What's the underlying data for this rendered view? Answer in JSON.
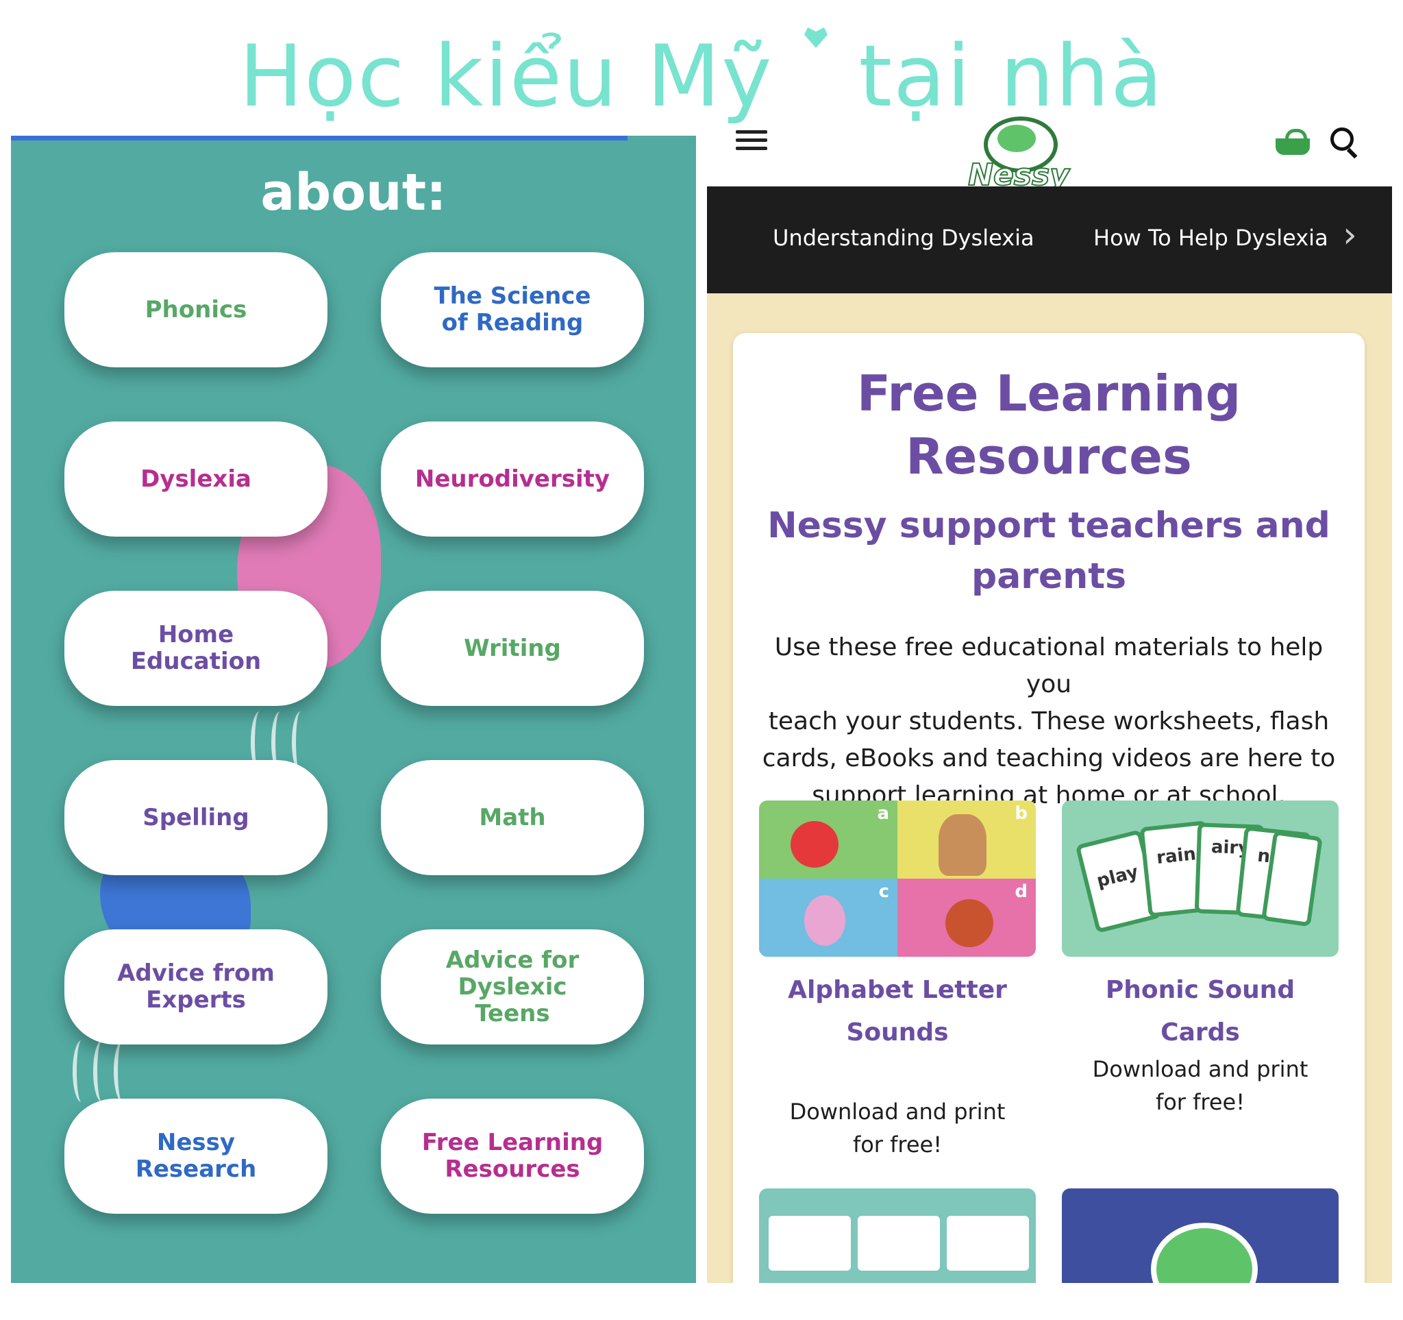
{
  "banner": {
    "text_part1": "Học kiểu Mỹ",
    "text_part2": "tại nhà"
  },
  "left_panel": {
    "heading": "about:",
    "buttons": [
      {
        "label_lines": [
          "Phonics"
        ],
        "color": "#58a766"
      },
      {
        "label_lines": [
          "The Science",
          "of Reading"
        ],
        "color": "#2f69c4"
      },
      {
        "label_lines": [
          "Dyslexia"
        ],
        "color": "#b62e8f"
      },
      {
        "label_lines": [
          "Neurodiversity"
        ],
        "color": "#b62e8f"
      },
      {
        "label_lines": [
          "Home",
          "Education"
        ],
        "color": "#6b4ea3"
      },
      {
        "label_lines": [
          "Writing"
        ],
        "color": "#58a766"
      },
      {
        "label_lines": [
          "Spelling"
        ],
        "color": "#6b4ea3"
      },
      {
        "label_lines": [
          "Math"
        ],
        "color": "#58a766"
      },
      {
        "label_lines": [
          "Advice from",
          "Experts"
        ],
        "color": "#6b4ea3"
      },
      {
        "label_lines": [
          "Advice for",
          "Dyslexic",
          "Teens"
        ],
        "color": "#58a766"
      },
      {
        "label_lines": [
          "Nessy",
          "Research"
        ],
        "color": "#2f69c4"
      },
      {
        "label_lines": [
          "Free Learning",
          "Resources"
        ],
        "color": "#b62e8f"
      }
    ]
  },
  "right_panel": {
    "header": {
      "logo_text": "Nessy",
      "menu_icon": "hamburger-icon",
      "cart_icon": "basket-icon",
      "search_icon": "search-icon"
    },
    "nav": {
      "items": [
        "Understanding Dyslexia",
        "How To Help Dyslexia"
      ],
      "next_icon": "chevron-right-icon"
    },
    "card": {
      "title_lines": [
        "Free Learning",
        "Resources"
      ],
      "subtitle_lines": [
        "Nessy support teachers and",
        "parents"
      ],
      "description_lines": [
        "Use these free educational materials to help you",
        "teach your students. These worksheets, flash",
        "cards, eBooks and teaching videos are here to",
        "support learning at home or at school."
      ],
      "resources": [
        {
          "title_lines": [
            "Alphabet Letter",
            "Sounds"
          ],
          "desc_lines": [
            "Download and print",
            "for free!"
          ],
          "quad_letters": [
            "a",
            "b",
            "c",
            "d"
          ]
        },
        {
          "title_lines": [
            "Phonic Sound Cards"
          ],
          "desc_lines": [
            "Download and print",
            "for free!"
          ],
          "card_words": [
            "play",
            "rain",
            "airy",
            "nch"
          ]
        }
      ]
    }
  },
  "colors": {
    "teal_bg": "#52aaa1",
    "cream_bg": "#f3e6bc",
    "purple": "#6b4ea3",
    "banner_mint": "#78e3cf",
    "nav_black": "#1d1d1d"
  }
}
